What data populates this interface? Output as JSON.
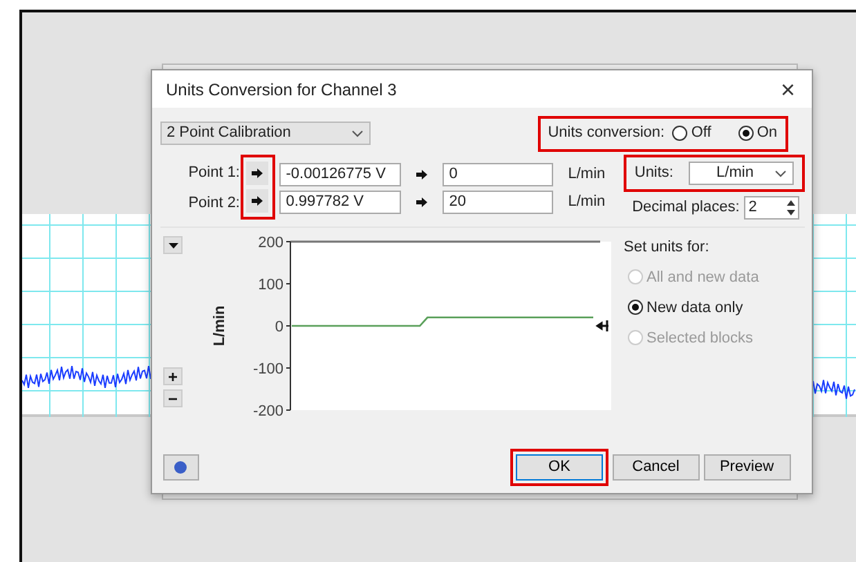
{
  "dialog": {
    "title": "Units Conversion for Channel 3",
    "close": "×"
  },
  "method": {
    "value": "2 Point Calibration"
  },
  "units_conversion": {
    "label": "Units conversion:",
    "highlighted": true,
    "options": [
      {
        "label": "Off",
        "selected": false
      },
      {
        "label": "On",
        "selected": true
      }
    ]
  },
  "arrow_buttons_highlighted": true,
  "points": [
    {
      "label": "Point 1:",
      "input": "-0.00126775 V",
      "output": "0",
      "unit": "L/min"
    },
    {
      "label": "Point 2:",
      "input": "0.997782 V",
      "output": "20",
      "unit": "L/min"
    }
  ],
  "units": {
    "label": "Units:",
    "value": "L/min",
    "highlighted": true
  },
  "decimal_places": {
    "label": "Decimal places:",
    "value": "2"
  },
  "chart": {
    "chart_data": {
      "type": "line",
      "ylabel": "L/min",
      "categories": [
        null,
        null,
        null,
        null,
        null,
        null,
        null,
        null,
        null,
        null,
        null,
        null,
        null,
        null,
        null,
        null,
        null,
        null,
        null,
        null,
        null,
        null,
        null,
        null,
        null,
        null,
        null,
        null,
        null,
        null,
        null,
        null,
        null,
        null,
        null,
        null,
        null,
        null,
        null,
        null,
        null
      ],
      "ylim": [
        -200,
        200
      ],
      "yticks": [
        200,
        100,
        0,
        -100,
        -200
      ],
      "series": [
        {
          "color": "#5aa05a",
          "values": [
            0,
            0,
            0,
            0,
            0,
            0,
            0,
            0,
            0,
            0,
            0,
            0,
            0,
            0,
            0,
            0,
            0,
            0,
            20,
            20,
            20,
            20,
            20,
            20,
            20,
            20,
            20,
            20,
            20,
            20,
            20,
            20,
            20,
            20,
            20,
            20,
            20,
            20,
            20,
            20,
            20
          ]
        }
      ]
    }
  },
  "set_units": {
    "label": "Set units for:",
    "options": [
      {
        "label": "All and new data",
        "selected": false,
        "disabled": true
      },
      {
        "label": "New data only",
        "selected": true,
        "disabled": false
      },
      {
        "label": "Selected blocks",
        "selected": false,
        "disabled": true
      }
    ]
  },
  "buttons": [
    {
      "label": "OK",
      "default": true,
      "highlighted": true
    },
    {
      "label": "Cancel",
      "default": false,
      "highlighted": false
    },
    {
      "label": "Preview",
      "default": false,
      "highlighted": false
    }
  ]
}
